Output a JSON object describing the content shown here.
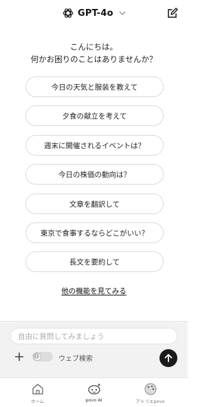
{
  "header": {
    "model_name": "GPT-4o"
  },
  "greeting": {
    "line1": "こんにちは。",
    "line2": "何かお困りのことはありませんか？"
  },
  "suggestions": [
    "今日の天気と服装を教えて",
    "夕食の献立を考えて",
    "週末に開催されるイベントは？",
    "今日の株価の動向は？",
    "文章を翻訳して",
    "東京で食事するならどこがいい？",
    "長文を要約して"
  ],
  "more_link": "他の機能を見てみる",
  "composer": {
    "placeholder": "自由に質問してみましょう",
    "web_search_label": "ウェブ検索",
    "web_search_enabled": false
  },
  "tabs": [
    {
      "label": "ホーム",
      "icon": "home-icon"
    },
    {
      "label": "povo AI",
      "icon": "robot-icon"
    },
    {
      "label": "アトリエpovo",
      "icon": "palette-icon"
    }
  ],
  "colors": {
    "send_button": "#1a1a1a",
    "composer_bg": "#f2f2f2"
  }
}
